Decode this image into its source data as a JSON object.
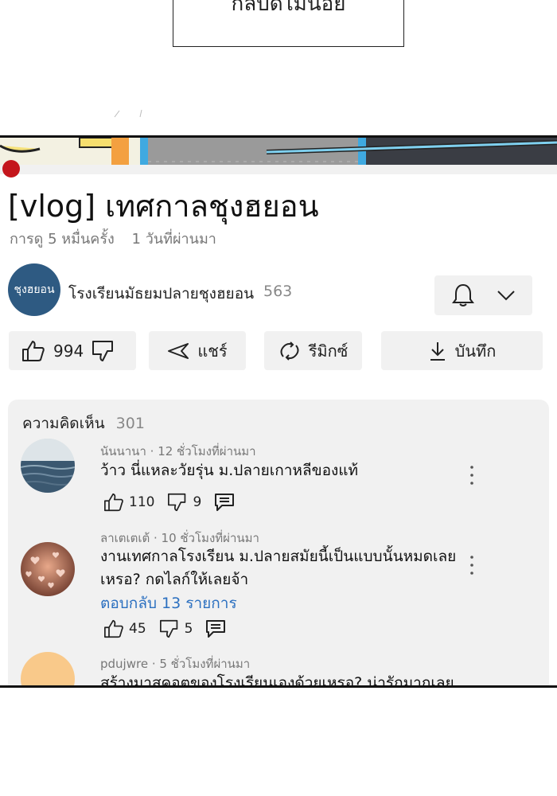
{
  "comic_panel": {
    "partial_text": "กลับดีไม่นอย"
  },
  "video": {
    "title": "[vlog] เทศกาลชุงฮยอน",
    "views": "การดู 5 หมื่นครั้ง",
    "age": "1 วันที่ผ่านมา",
    "accent_color": "#c4161c"
  },
  "channel": {
    "avatar_text": "ชุงฮยอน",
    "name": "โรงเรียนมัธยมปลายชุงฮยอน",
    "subscribers": "563",
    "avatar_color": "#2e5a82"
  },
  "actions": {
    "likes": "994",
    "share_label": "แชร์",
    "remix_label": "รีมิกซ์",
    "save_label": "บันทึก"
  },
  "comments": {
    "header_label": "ความคิดเห็น",
    "count": "301",
    "items": [
      {
        "author": "นันนานา",
        "time": "12 ชั่วโมงที่ผ่านมา",
        "text": "ว้าว นี่แหละวัยรุ่น ม.ปลายเกาหลีของแท้",
        "likes": "110",
        "dislikes": "9"
      },
      {
        "author": "ลาเตเตเต้",
        "time": "10 ชั่วโมงที่ผ่านมา",
        "text": "งานเทศกาลโรงเรียน ม.ปลายสมัยนี้เป็นแบบนั้นหมดเลยเหรอ? กดไลก์ให้เลยจ้า",
        "reply_label": "ตอบกลับ 13 รายการ",
        "likes": "45",
        "dislikes": "5"
      },
      {
        "author": "pdujwre",
        "time": "5 ชั่วโมงที่ผ่านมา",
        "text": "สร้างมาสคอตของโรงเรียนเองด้วยเหรอ? น่ารักมากเลย"
      }
    ]
  }
}
